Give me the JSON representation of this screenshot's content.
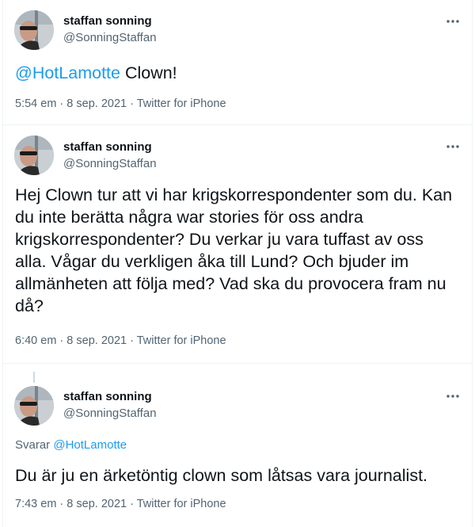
{
  "tweets": [
    {
      "name": "staffan sonning",
      "handle": "@SonningStaffan",
      "mention": "@HotLamotte",
      "text": " Clown!",
      "time": "5:54 em",
      "date": "8 sep. 2021",
      "source": "Twitter for iPhone"
    },
    {
      "name": "staffan sonning",
      "handle": "@SonningStaffan",
      "text": "Hej Clown tur att vi har krigskorrespondenter som du. Kan du inte berätta några war stories för oss andra krigskorrespondenter? Du verkar ju vara tuffast av oss alla. Vågar du verkligen åka till Lund? Och bjuder im allmänheten att följa med? Vad ska du provocera fram nu då?",
      "time": "6:40 em",
      "date": "8 sep. 2021",
      "source": "Twitter for iPhone"
    },
    {
      "name": "staffan sonning",
      "handle": "@SonningStaffan",
      "reply_label": "Svarar",
      "reply_mention": "@HotLamotte",
      "text": "Du är ju en ärketöntig clown som låtsas vara journalist.",
      "time": "7:43 em",
      "date": "8 sep. 2021",
      "source": "Twitter for iPhone"
    }
  ],
  "separator": " · ",
  "icons": {
    "more": "more-dots-icon",
    "avatar": "profile-photo"
  },
  "colors": {
    "link": "#1d9bf0",
    "secondary": "#536471",
    "text": "#0f1419",
    "border": "#eff3f4"
  }
}
